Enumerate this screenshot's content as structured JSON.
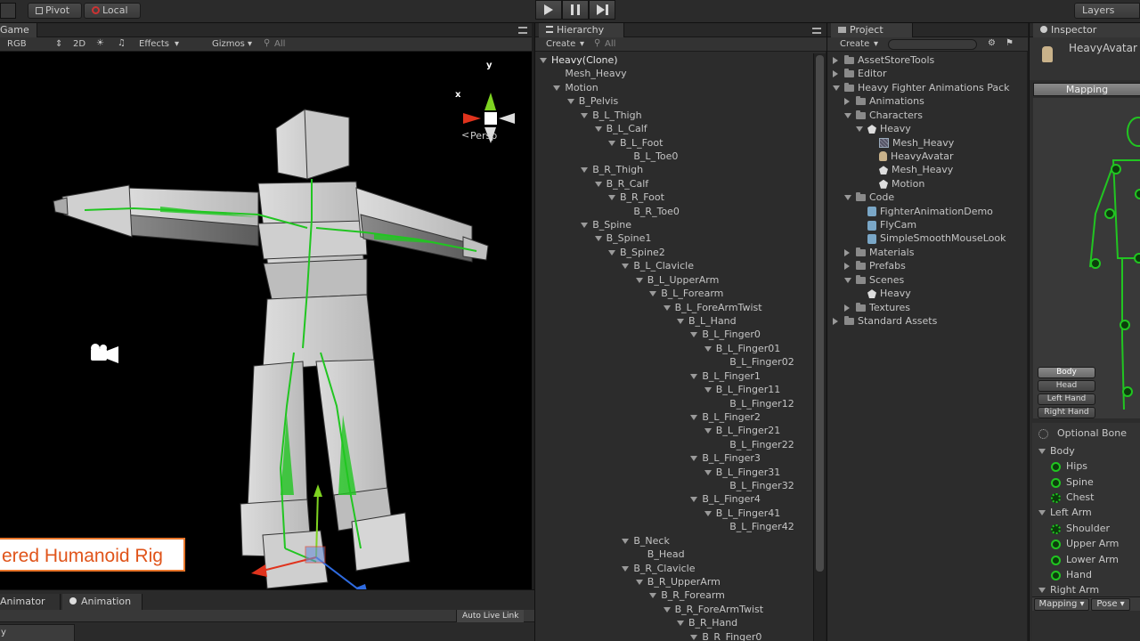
{
  "toolbar": {
    "pivot_label": "Pivot",
    "local_label": "Local",
    "layers_label": "Layers"
  },
  "game": {
    "tab_label": "Game",
    "rgb_label": "RGB",
    "mode_2d": "2D",
    "effects_label": "Effects",
    "gizmos_label": "Gizmos",
    "search_placeholder": "All",
    "persp_label": "Persp",
    "gizmo_y": "y",
    "gizmo_x": "x",
    "caption": "ered Humanoid Rig"
  },
  "bottom": {
    "animator_tab": "Animator",
    "animation_tab": "Animation",
    "auto_live_link": "Auto Live Link",
    "field_value": "y"
  },
  "hierarchy": {
    "tab_label": "Hierarchy",
    "create_label": "Create",
    "search_placeholder": "All",
    "items": [
      {
        "label": "Heavy(Clone)",
        "depth": 0,
        "expanded": true
      },
      {
        "label": "Mesh_Heavy",
        "depth": 1,
        "expanded": null
      },
      {
        "label": "Motion",
        "depth": 1,
        "expanded": true
      },
      {
        "label": "B_Pelvis",
        "depth": 2,
        "expanded": true
      },
      {
        "label": "B_L_Thigh",
        "depth": 3,
        "expanded": true
      },
      {
        "label": "B_L_Calf",
        "depth": 4,
        "expanded": true
      },
      {
        "label": "B_L_Foot",
        "depth": 5,
        "expanded": true
      },
      {
        "label": "B_L_Toe0",
        "depth": 6,
        "expanded": null
      },
      {
        "label": "B_R_Thigh",
        "depth": 3,
        "expanded": true
      },
      {
        "label": "B_R_Calf",
        "depth": 4,
        "expanded": true
      },
      {
        "label": "B_R_Foot",
        "depth": 5,
        "expanded": true
      },
      {
        "label": "B_R_Toe0",
        "depth": 6,
        "expanded": null
      },
      {
        "label": "B_Spine",
        "depth": 3,
        "expanded": true
      },
      {
        "label": "B_Spine1",
        "depth": 4,
        "expanded": true
      },
      {
        "label": "B_Spine2",
        "depth": 5,
        "expanded": true
      },
      {
        "label": "B_L_Clavicle",
        "depth": 6,
        "expanded": true
      },
      {
        "label": "B_L_UpperArm",
        "depth": 7,
        "expanded": true
      },
      {
        "label": "B_L_Forearm",
        "depth": 8,
        "expanded": true
      },
      {
        "label": "B_L_ForeArmTwist",
        "depth": 9,
        "expanded": true
      },
      {
        "label": "B_L_Hand",
        "depth": 10,
        "expanded": true
      },
      {
        "label": "B_L_Finger0",
        "depth": 11,
        "expanded": true
      },
      {
        "label": "B_L_Finger01",
        "depth": 12,
        "expanded": true
      },
      {
        "label": "B_L_Finger02",
        "depth": 13,
        "expanded": null
      },
      {
        "label": "B_L_Finger1",
        "depth": 11,
        "expanded": true
      },
      {
        "label": "B_L_Finger11",
        "depth": 12,
        "expanded": true
      },
      {
        "label": "B_L_Finger12",
        "depth": 13,
        "expanded": null
      },
      {
        "label": "B_L_Finger2",
        "depth": 11,
        "expanded": true
      },
      {
        "label": "B_L_Finger21",
        "depth": 12,
        "expanded": true
      },
      {
        "label": "B_L_Finger22",
        "depth": 13,
        "expanded": null
      },
      {
        "label": "B_L_Finger3",
        "depth": 11,
        "expanded": true
      },
      {
        "label": "B_L_Finger31",
        "depth": 12,
        "expanded": true
      },
      {
        "label": "B_L_Finger32",
        "depth": 13,
        "expanded": null
      },
      {
        "label": "B_L_Finger4",
        "depth": 11,
        "expanded": true
      },
      {
        "label": "B_L_Finger41",
        "depth": 12,
        "expanded": true
      },
      {
        "label": "B_L_Finger42",
        "depth": 13,
        "expanded": null
      },
      {
        "label": "B_Neck",
        "depth": 6,
        "expanded": true
      },
      {
        "label": "B_Head",
        "depth": 7,
        "expanded": null
      },
      {
        "label": "B_R_Clavicle",
        "depth": 6,
        "expanded": true
      },
      {
        "label": "B_R_UpperArm",
        "depth": 7,
        "expanded": true
      },
      {
        "label": "B_R_Forearm",
        "depth": 8,
        "expanded": true
      },
      {
        "label": "B_R_ForeArmTwist",
        "depth": 9,
        "expanded": true
      },
      {
        "label": "B_R_Hand",
        "depth": 10,
        "expanded": true
      },
      {
        "label": "B_R_Finger0",
        "depth": 11,
        "expanded": true
      }
    ]
  },
  "project": {
    "tab_label": "Project",
    "create_label": "Create",
    "items": [
      {
        "label": "AssetStoreTools",
        "depth": 0,
        "icon": "folder",
        "expanded": false
      },
      {
        "label": "Editor",
        "depth": 0,
        "icon": "folder",
        "expanded": false
      },
      {
        "label": "Heavy Fighter Animations Pack",
        "depth": 0,
        "icon": "folder",
        "expanded": true
      },
      {
        "label": "Animations",
        "depth": 1,
        "icon": "folder",
        "expanded": false
      },
      {
        "label": "Characters",
        "depth": 1,
        "icon": "folder",
        "expanded": true
      },
      {
        "label": "Heavy",
        "depth": 2,
        "icon": "model",
        "expanded": true
      },
      {
        "label": "Mesh_Heavy",
        "depth": 3,
        "icon": "mesh",
        "expanded": null
      },
      {
        "label": "HeavyAvatar",
        "depth": 3,
        "icon": "avatar",
        "expanded": null
      },
      {
        "label": "Mesh_Heavy",
        "depth": 3,
        "icon": "model",
        "expanded": null
      },
      {
        "label": "Motion",
        "depth": 3,
        "icon": "model",
        "expanded": null
      },
      {
        "label": "Code",
        "depth": 1,
        "icon": "folder",
        "expanded": true
      },
      {
        "label": "FighterAnimationDemo",
        "depth": 2,
        "icon": "script",
        "expanded": null
      },
      {
        "label": "FlyCam",
        "depth": 2,
        "icon": "script",
        "expanded": null
      },
      {
        "label": "SimpleSmoothMouseLook",
        "depth": 2,
        "icon": "script",
        "expanded": null
      },
      {
        "label": "Materials",
        "depth": 1,
        "icon": "folder",
        "expanded": false
      },
      {
        "label": "Prefabs",
        "depth": 1,
        "icon": "folder",
        "expanded": false
      },
      {
        "label": "Scenes",
        "depth": 1,
        "icon": "folder",
        "expanded": true
      },
      {
        "label": "Heavy",
        "depth": 2,
        "icon": "unity",
        "expanded": null
      },
      {
        "label": "Textures",
        "depth": 1,
        "icon": "folder",
        "expanded": false
      },
      {
        "label": "Standard Assets",
        "depth": 0,
        "icon": "folder",
        "expanded": false
      }
    ]
  },
  "inspector": {
    "tab_label": "Inspector",
    "object_name": "HeavyAvatar",
    "mapping_tab": "Mapping",
    "body_buttons": [
      "Body",
      "Head",
      "Left Hand",
      "Right Hand"
    ],
    "optional_bone": "Optional Bone",
    "body_section": "Body",
    "body_bones": [
      "Hips",
      "Spine",
      "Chest"
    ],
    "left_arm_section": "Left Arm",
    "left_arm_bones": [
      "Shoulder",
      "Upper Arm",
      "Lower Arm",
      "Hand"
    ],
    "right_arm_section": "Right Arm",
    "footer_mapping": "Mapping",
    "footer_pose": "Pose"
  },
  "colors": {
    "bone_green": "#21c521",
    "caption_border": "#e8752a",
    "gizmo_y": "#7ed321",
    "gizmo_x": "#e0331d",
    "gizmo_z": "#2f6be0"
  }
}
